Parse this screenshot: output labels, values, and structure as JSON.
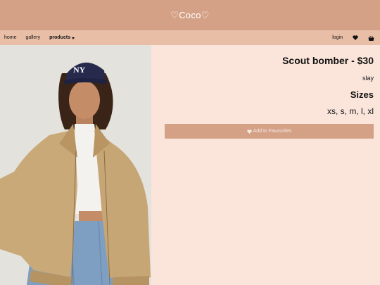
{
  "header": {
    "brand": "♡Coco♡"
  },
  "nav": {
    "home": "home",
    "gallery": "gallery",
    "products": "products",
    "login": "login",
    "icons": [
      "heart-icon",
      "bag-icon"
    ]
  },
  "product": {
    "title": "Scout bomber - $30",
    "description": "slay",
    "sizes_heading": "Sizes",
    "sizes": "xs, s, m, l, xl",
    "favourite_label": "Add to Favourites",
    "cap_text": "NY"
  },
  "colors": {
    "header": "#d4a187",
    "nav": "#e8bea7",
    "page": "#fbe5da",
    "button": "#d4a187"
  }
}
